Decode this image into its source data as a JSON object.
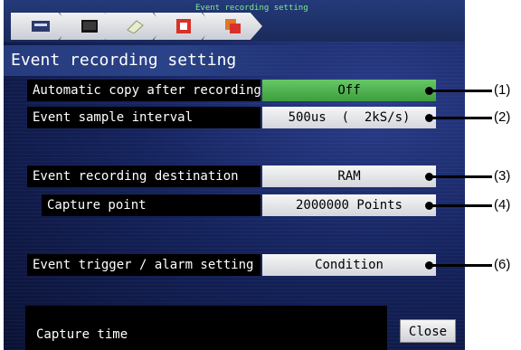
{
  "topbar": {
    "title": "Event recording setting",
    "steps": [
      {
        "icon": "panel-icon"
      },
      {
        "icon": "monitor-icon"
      },
      {
        "icon": "document-icon"
      },
      {
        "icon": "record-icon"
      },
      {
        "icon": "copy-icon"
      }
    ]
  },
  "heading": "Event recording setting",
  "settings": [
    {
      "label": "Automatic copy after recording",
      "value": "Off",
      "callout": "(1)"
    },
    {
      "label": "Event sample interval",
      "value": "500us  (  2kS/s)",
      "callout": "(2)"
    },
    {
      "label": "Event recording destination",
      "value": "RAM",
      "callout": "(3)"
    },
    {
      "label": "Capture point",
      "value": "2000000 Points",
      "callout": "(4)"
    },
    {
      "label": "Event trigger / alarm setting",
      "value": "Condition",
      "callout": "(6)"
    }
  ],
  "footer": {
    "capture_time_label": "Capture time",
    "close_label": "Close"
  },
  "colors": {
    "accent_green": "#4fb84f",
    "title_green": "#7cf08a",
    "screen_bg": "#15235e"
  }
}
